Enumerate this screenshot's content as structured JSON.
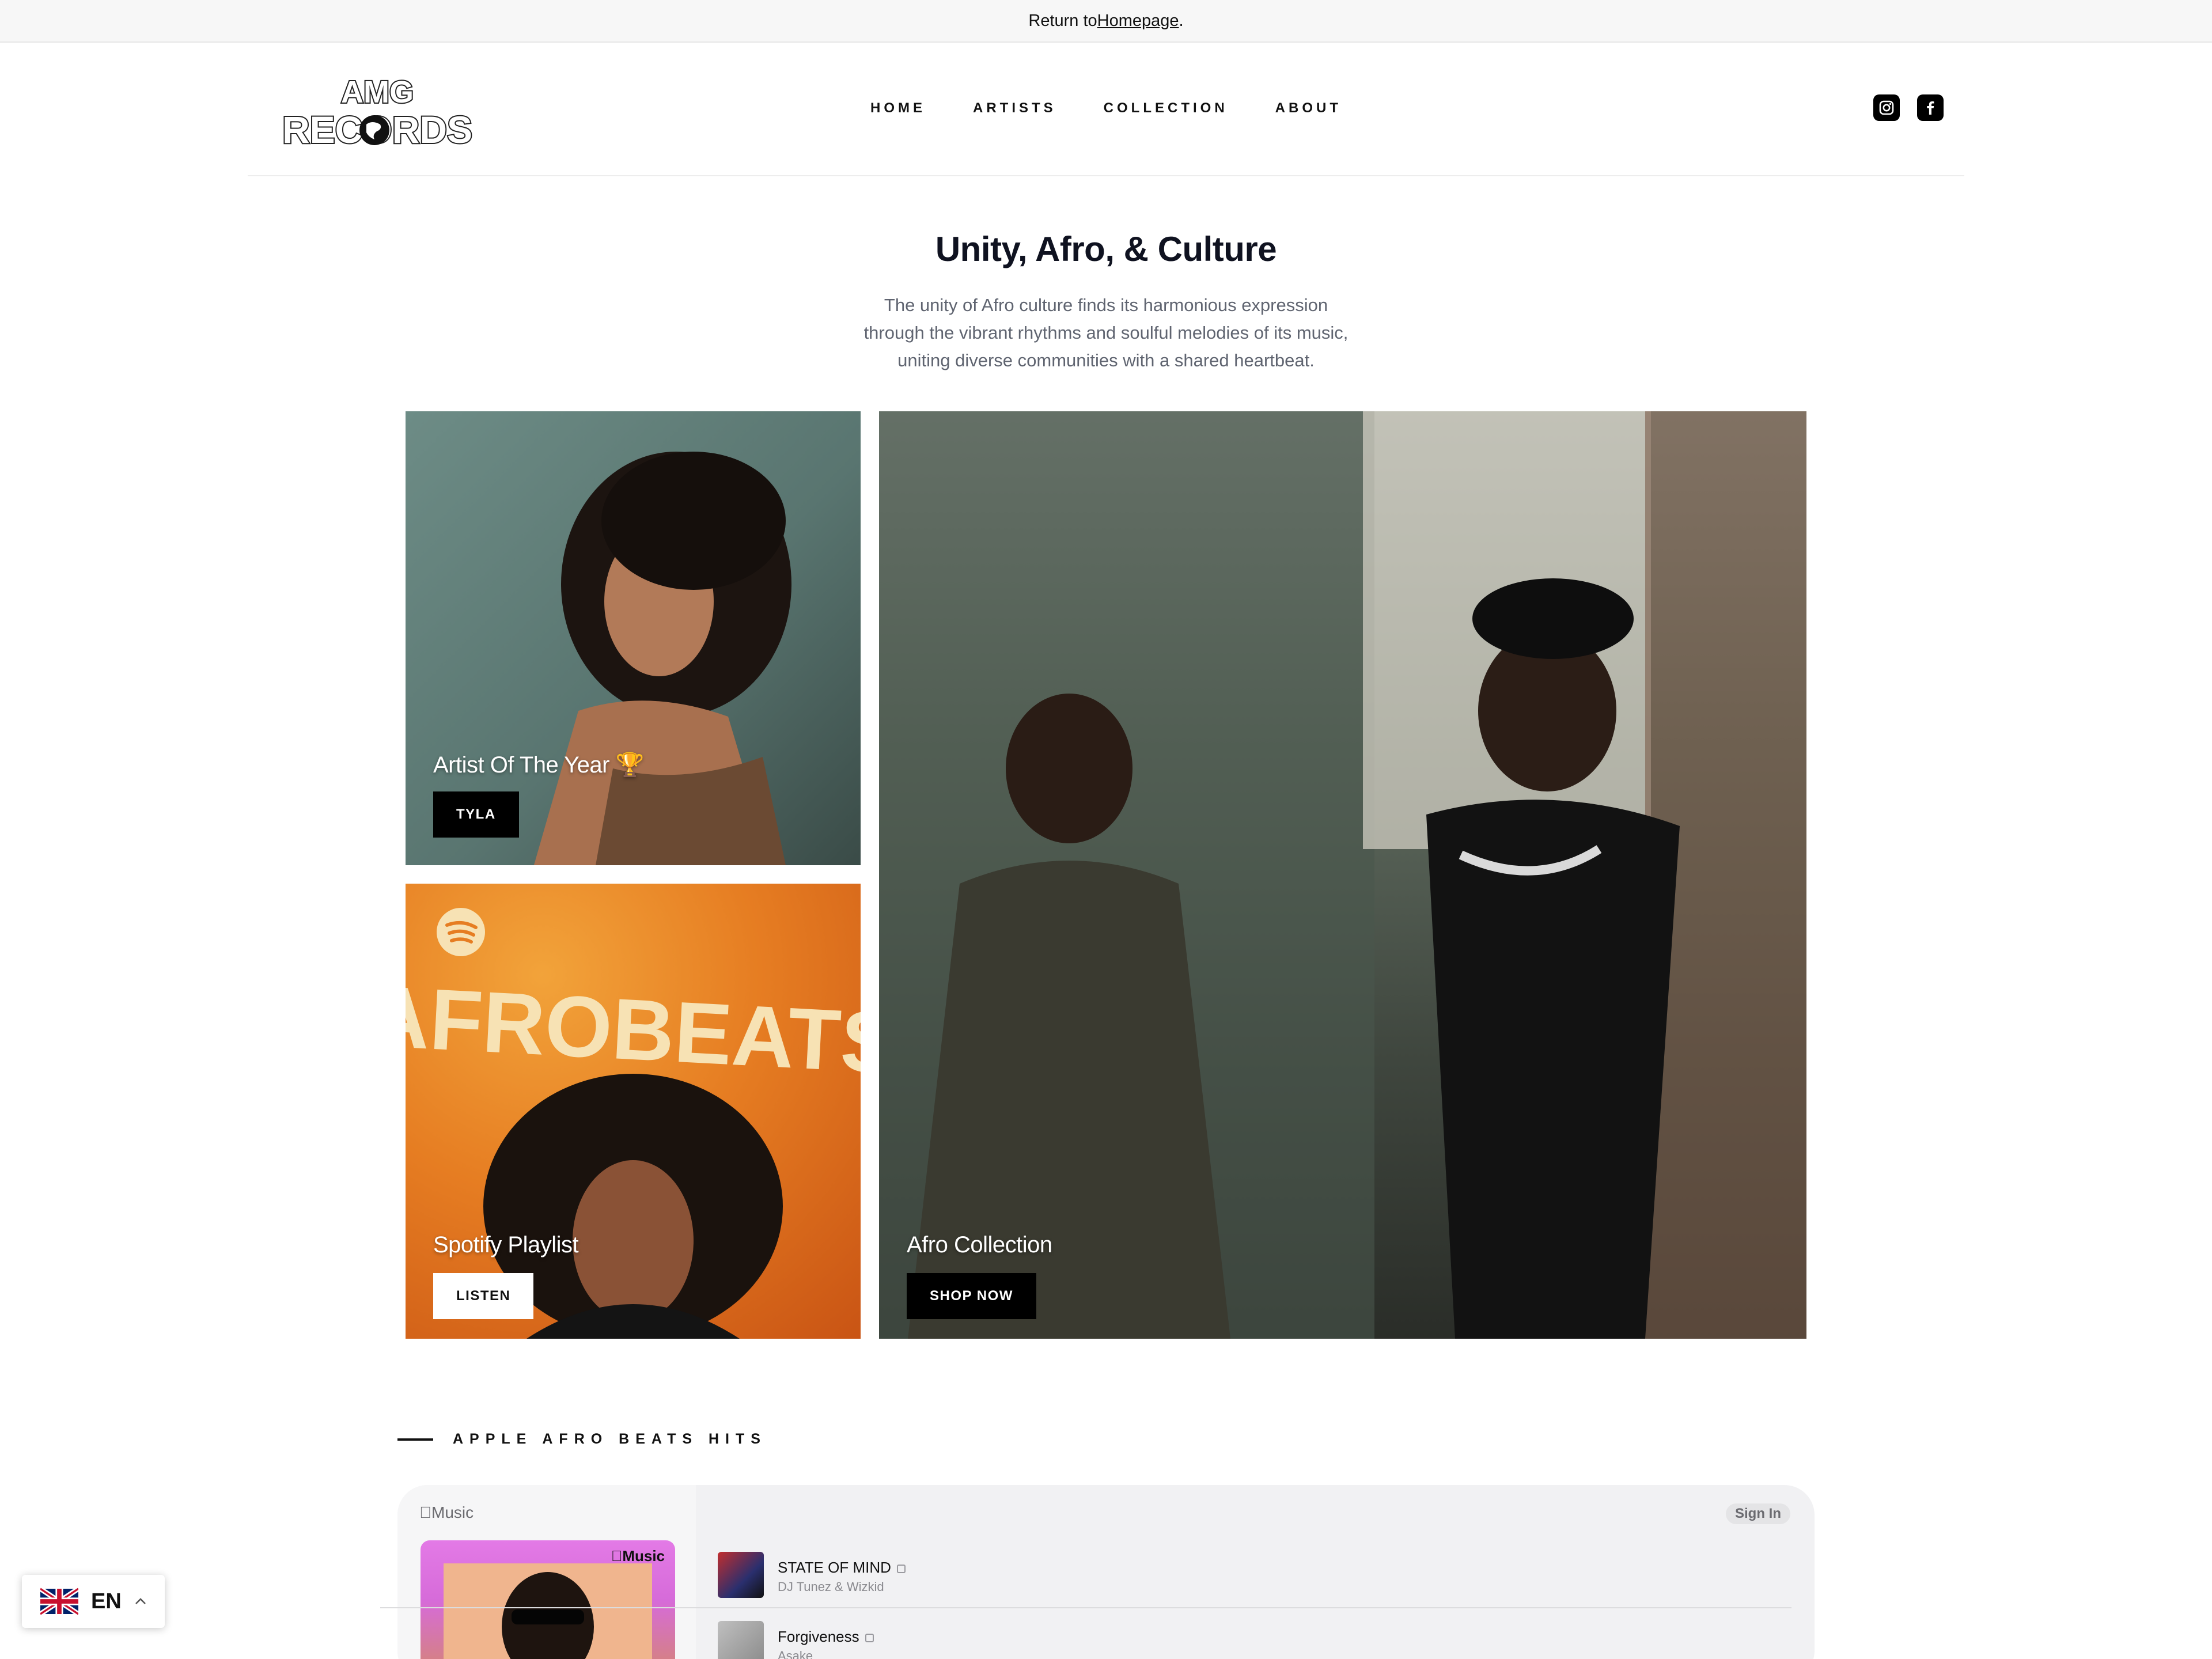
{
  "announcement": {
    "prefix": "Return to ",
    "link": "Homepage",
    "suffix": "."
  },
  "header": {
    "logo_text_top": "AMG",
    "logo_text_bottom": "RECORDS",
    "nav": [
      "HOME",
      "ARTISTS",
      "COLLECTION",
      "ABOUT"
    ],
    "social": [
      "instagram-icon",
      "facebook-icon"
    ]
  },
  "hero": {
    "title": "Unity, Afro, & Culture",
    "description_lines": [
      "The unity of Afro culture finds its harmonious expression",
      "through the vibrant rhythms and soulful melodies of its music,",
      "uniting diverse communities with a shared heartbeat."
    ]
  },
  "tiles": {
    "artist": {
      "label": "Artist Of The Year 🏆",
      "button": "TYLA"
    },
    "spotify": {
      "cover_text": "AFROBEATS",
      "label": "Spotify Playlist",
      "button": "LISTEN"
    },
    "collection": {
      "label": "Afro Collection",
      "button": "SHOP NOW"
    }
  },
  "section": {
    "title": "APPLE AFRO BEATS HITS"
  },
  "apple_widget": {
    "brand": "Music",
    "sign_in": "Sign In",
    "cover_tag": "Music",
    "tracks": [
      {
        "title": "STATE OF MIND",
        "artist": "DJ Tunez & Wizkid"
      },
      {
        "title": "Forgiveness",
        "artist": "Asake"
      }
    ]
  },
  "language": {
    "code": "EN"
  },
  "colors": {
    "text_dark": "#111111",
    "muted_text": "#5f6470",
    "spotify_orange": "#e67d22",
    "apple_pink": "#d66bd9"
  }
}
